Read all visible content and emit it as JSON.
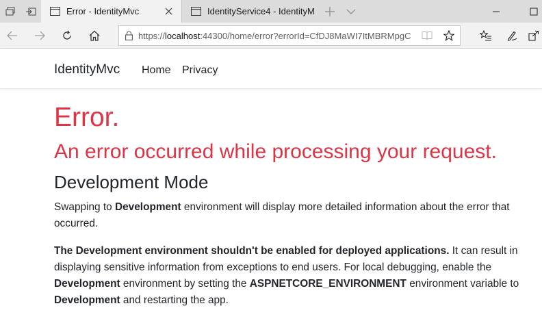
{
  "browser": {
    "tabs": [
      {
        "title": "Error - IdentityMvc",
        "active": true
      },
      {
        "title": "IdentityService4 - IdentityM",
        "active": false
      }
    ],
    "address": {
      "url_prefix": "https://",
      "url_host": "localhost",
      "url_rest": ":44300/home/error?errorId=CfDJ8MaWI7ItMBRMpgC"
    }
  },
  "site": {
    "brand": "IdentityMvc",
    "nav": [
      {
        "label": "Home"
      },
      {
        "label": "Privacy"
      }
    ]
  },
  "content": {
    "heading": "Error.",
    "subheading": "An error occurred while processing your request.",
    "mode_title": "Development Mode",
    "p1": {
      "t1": "Swapping to ",
      "b1": "Development",
      "t2": " environment will display more detailed information about the error that occurred."
    },
    "p2": {
      "b1": "The Development environment shouldn't be enabled for deployed applications.",
      "t1": " It can result in displaying sensitive information from exceptions to end users. For local debugging, enable the ",
      "b2": "Development",
      "t2": " environment by setting the ",
      "b3": "ASPNETCORE_ENVIRONMENT",
      "t3": " environment variable to ",
      "b4": "Development",
      "t4": " and restarting the app."
    }
  }
}
